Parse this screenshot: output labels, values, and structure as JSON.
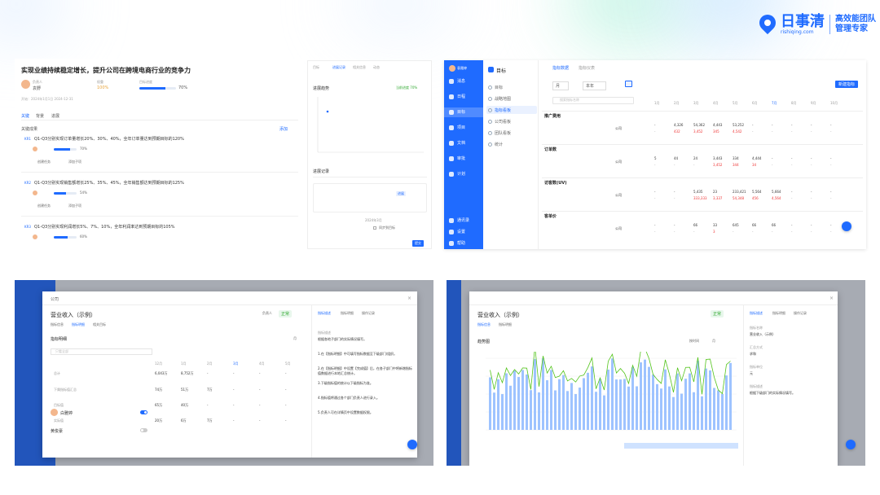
{
  "brand": {
    "name": "日事清",
    "url": "rishiqing.com",
    "slogan_1": "高效能团队",
    "slogan_2": "管理专家",
    "color": "#1f6bff"
  },
  "okr": {
    "title": "实现业绩持续稳定增长，提升公司在跨境电商行业的竞争力",
    "owner_label": "负责人",
    "owner": "袁野",
    "weight_label": "权重",
    "weight": "100%",
    "progress_label": "目标进度",
    "progress_pct": 70,
    "progress_text": "70%",
    "meta": "开始：2024年1月1日   2024-12-31",
    "tabs": [
      "关键",
      "背景",
      "进展"
    ],
    "section_label": "关键成果",
    "add_label": "添加",
    "krs": [
      {
        "code": "KR1",
        "text": "Q1-Q3分别实现订单量增长20%、30%、40%，全年订单量达到预期目标的120%",
        "pct_text": "70%",
        "pct": 70
      },
      {
        "code": "KR2",
        "text": "Q1-Q3分别实现销售额增长25%、35%、45%，全年销售额达到预期目标的125%",
        "pct_text": "54%",
        "pct": 54
      },
      {
        "code": "KR3",
        "text": "Q1-Q3分别实现利润增长5%、7%、10%，全年利润率达到预期目标的105%",
        "pct_text": "60%",
        "pct": 60
      }
    ],
    "kr_actions": [
      "创建任务",
      "添加子项"
    ]
  },
  "progress_panel": {
    "tabs": [
      "目标",
      "进展记录",
      "相关信息",
      "动态"
    ],
    "chart_title": "进展趋势",
    "chart_note": "当前进度 70%",
    "records_title": "进展记录",
    "record_tag": "进展",
    "record_date": "2024年3月",
    "checkbox_label": "同步到目标",
    "submit_label": "提交"
  },
  "indicator": {
    "app_title": "目标",
    "user": "袁雅婷",
    "sidebar": [
      "消息",
      "日程",
      "目标",
      "项目",
      "文档",
      "审批",
      "计划",
      "通讯录",
      "设置",
      "帮助"
    ],
    "nav": [
      "目标",
      "战略地图",
      "指标看板",
      "公司看板",
      "团队看板",
      "统计"
    ],
    "tabs": [
      "指标数据",
      "指标仪表"
    ],
    "view_options": [
      "月",
      "本年"
    ],
    "new_button": "新建指标",
    "search_placeholder": "搜索指标名称",
    "months": [
      "1月",
      "2月",
      "3月",
      "4月",
      "5月",
      "6月",
      "7月",
      "8月",
      "9月",
      "10月"
    ],
    "sections": [
      {
        "name": "推广费用",
        "row_label": "公司",
        "values": [
          "-",
          "4,326",
          "54,362",
          "4,443",
          "53,252",
          "-",
          "-",
          "-",
          "-",
          "-"
        ],
        "deltas": [
          "-",
          "432",
          "3,452",
          "345",
          "4,542",
          "-",
          "-",
          "-",
          "-",
          "-"
        ]
      },
      {
        "name": "订单数",
        "row_label": "公司",
        "values": [
          "5",
          "44",
          "24",
          "3,443",
          "334",
          "4,444",
          "-",
          "-",
          "-",
          "-"
        ],
        "deltas": [
          "-",
          "-",
          "-",
          "3,452",
          "344",
          "34",
          "-",
          "-",
          "-",
          "-"
        ]
      },
      {
        "name": "访客数(UV)",
        "row_label": "公司",
        "values": [
          "-",
          "-",
          "5,435",
          "23",
          "233,421",
          "5,564",
          "5,664",
          "-",
          "-",
          "-"
        ],
        "deltas": [
          "-",
          "-",
          "333,333",
          "3,337",
          "54,348",
          "456",
          "4,564",
          "-",
          "-",
          "-"
        ]
      },
      {
        "name": "客单价",
        "row_label": "公司",
        "values": [
          "-",
          "-",
          "66",
          "33",
          "645",
          "66",
          "66",
          "-",
          "-",
          "-"
        ],
        "deltas": [
          "-",
          "-",
          "-",
          "3",
          "-",
          "-",
          "-",
          "-",
          "-",
          "-"
        ]
      }
    ]
  },
  "revenue_modal": {
    "breadcrumb": "公司",
    "title": "营业收入（示例）",
    "status": "正常",
    "owner": "负责人",
    "tabs": [
      "指标信息",
      "指标明细",
      "相关目标"
    ],
    "detail_tabs": [
      "指标描述",
      "指标明细",
      "操作记录"
    ],
    "grid_title": "指标明细",
    "filter": "只看全部",
    "col_period": "月",
    "columns": [
      "12月",
      "1月",
      "2月",
      "3月",
      "4月",
      "5月"
    ],
    "rows": [
      {
        "label": "总计",
        "values": [
          "6,043万",
          "8,752万",
          "-",
          "-",
          "-",
          "-"
        ]
      },
      {
        "label": "下属指标值汇总",
        "values": [
          "74万",
          "51万",
          "7万",
          "-",
          "-",
          "-"
        ]
      },
      {
        "label": "目标值",
        "values": [
          "65万",
          "40万",
          "-",
          "-",
          "-",
          "-"
        ]
      },
      {
        "label": "实际值",
        "values": [
          "20万",
          "6万",
          "7万",
          "-",
          "-",
          "-"
        ]
      }
    ],
    "person_1": "白雅婷",
    "person_2": "黄俊豪",
    "desc_label": "指标描述",
    "desc": "根据各地子部门的实际情况填写。",
    "notes": [
      "1.在【指标明细】中可填写指标数据至下级部门/组织。",
      "2.在【指标明细】中设置【完成值】后，在各子部门中将新增指标值数据进行本地汇总统计。",
      "3.下级指标值的统计以下级指标为准。",
      "4.指标值将通过各个部门负责人进行录入。",
      "5.负责人可在详情页中设置数据权限。"
    ]
  },
  "trend_modal": {
    "title": "营业收入（示例）",
    "status": "正常",
    "tabs": [
      "指标信息",
      "指标明细"
    ],
    "detail_tabs": [
      "指标描述",
      "指标明细",
      "操作记录"
    ],
    "chart_title": "趋势图",
    "chart_options": [
      "按时间",
      "月"
    ],
    "side_sections": [
      {
        "label": "指标名称",
        "value": "营业收入（示例）"
      },
      {
        "label": "汇总方式",
        "value": "求和"
      },
      {
        "label": "指标单位",
        "value": "元"
      },
      {
        "label": "指标描述",
        "value": "根据下级部门的实际情况填写。"
      }
    ]
  }
}
